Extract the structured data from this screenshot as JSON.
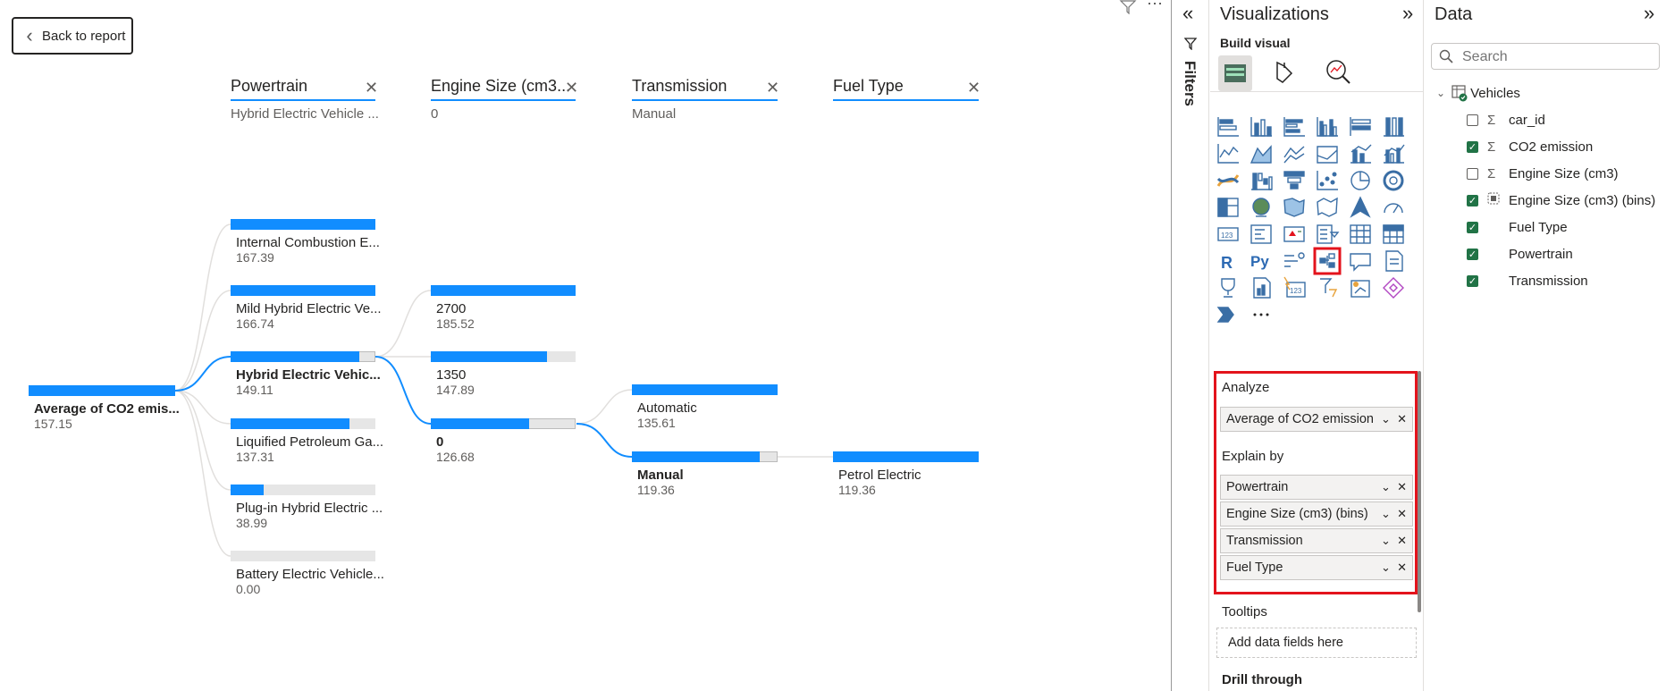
{
  "canvas": {
    "back_label": "Back to report",
    "levels": [
      {
        "header": "Powertrain",
        "selected": "Hybrid Electric Vehicle ..."
      },
      {
        "header": "Engine Size (cm3...",
        "selected": "0"
      },
      {
        "header": "Transmission",
        "selected": "Manual"
      },
      {
        "header": "Fuel Type",
        "selected": ""
      }
    ],
    "root": {
      "label": "Average of CO2 emis...",
      "value": "157.15",
      "fraction": 1.0
    },
    "powertrain_nodes": [
      {
        "label": "Internal Combustion E...",
        "value": "167.39",
        "fraction": 1.0
      },
      {
        "label": "Mild Hybrid Electric Ve...",
        "value": "166.74",
        "fraction": 1.0
      },
      {
        "label": "Hybrid Electric Vehic...",
        "value": "149.11",
        "fraction": 0.89
      },
      {
        "label": "Liquified Petroleum Ga...",
        "value": "137.31",
        "fraction": 0.82
      },
      {
        "label": "Plug-in Hybrid Electric ...",
        "value": "38.99",
        "fraction": 0.23
      },
      {
        "label": "Battery Electric Vehicle...",
        "value": "0.00",
        "fraction": 0.0
      }
    ],
    "engine_nodes": [
      {
        "label": "2700",
        "value": "185.52",
        "fraction": 1.0
      },
      {
        "label": "1350",
        "value": "147.89",
        "fraction": 0.8
      },
      {
        "label": "0",
        "value": "126.68",
        "fraction": 0.68
      }
    ],
    "transmission_nodes": [
      {
        "label": "Automatic",
        "value": "135.61",
        "fraction": 1.0
      },
      {
        "label": "Manual",
        "value": "119.36",
        "fraction": 0.88
      }
    ],
    "fuel_nodes": [
      {
        "label": "Petrol Electric",
        "value": "119.36",
        "fraction": 1.0
      }
    ]
  },
  "filters": {
    "label": "Filters"
  },
  "visualizations": {
    "title": "Visualizations",
    "build_visual": "Build visual",
    "analyze_label": "Analyze",
    "analyze_field": "Average of CO2 emission",
    "explain_by_label": "Explain by",
    "explain_fields": [
      "Powertrain",
      "Engine Size (cm3) (bins)",
      "Transmission",
      "Fuel Type"
    ],
    "tooltips_label": "Tooltips",
    "tooltips_placeholder": "Add data fields here",
    "drill_through_label": "Drill through"
  },
  "data_pane": {
    "title": "Data",
    "search_placeholder": "Search",
    "table_name": "Vehicles",
    "fields": [
      {
        "name": "car_id",
        "checked": false,
        "icon": "sigma-icon"
      },
      {
        "name": "CO2 emission",
        "checked": true,
        "icon": "sigma-icon"
      },
      {
        "name": "Engine Size (cm3)",
        "checked": false,
        "icon": "sigma-icon"
      },
      {
        "name": "Engine Size (cm3) (bins)",
        "checked": true,
        "icon": "bins-icon"
      },
      {
        "name": "Fuel Type",
        "checked": true,
        "icon": ""
      },
      {
        "name": "Powertrain",
        "checked": true,
        "icon": ""
      },
      {
        "name": "Transmission",
        "checked": true,
        "icon": ""
      }
    ]
  },
  "colors": {
    "accent": "#118DFF",
    "highlight": "#E3131C",
    "check": "#217346"
  }
}
